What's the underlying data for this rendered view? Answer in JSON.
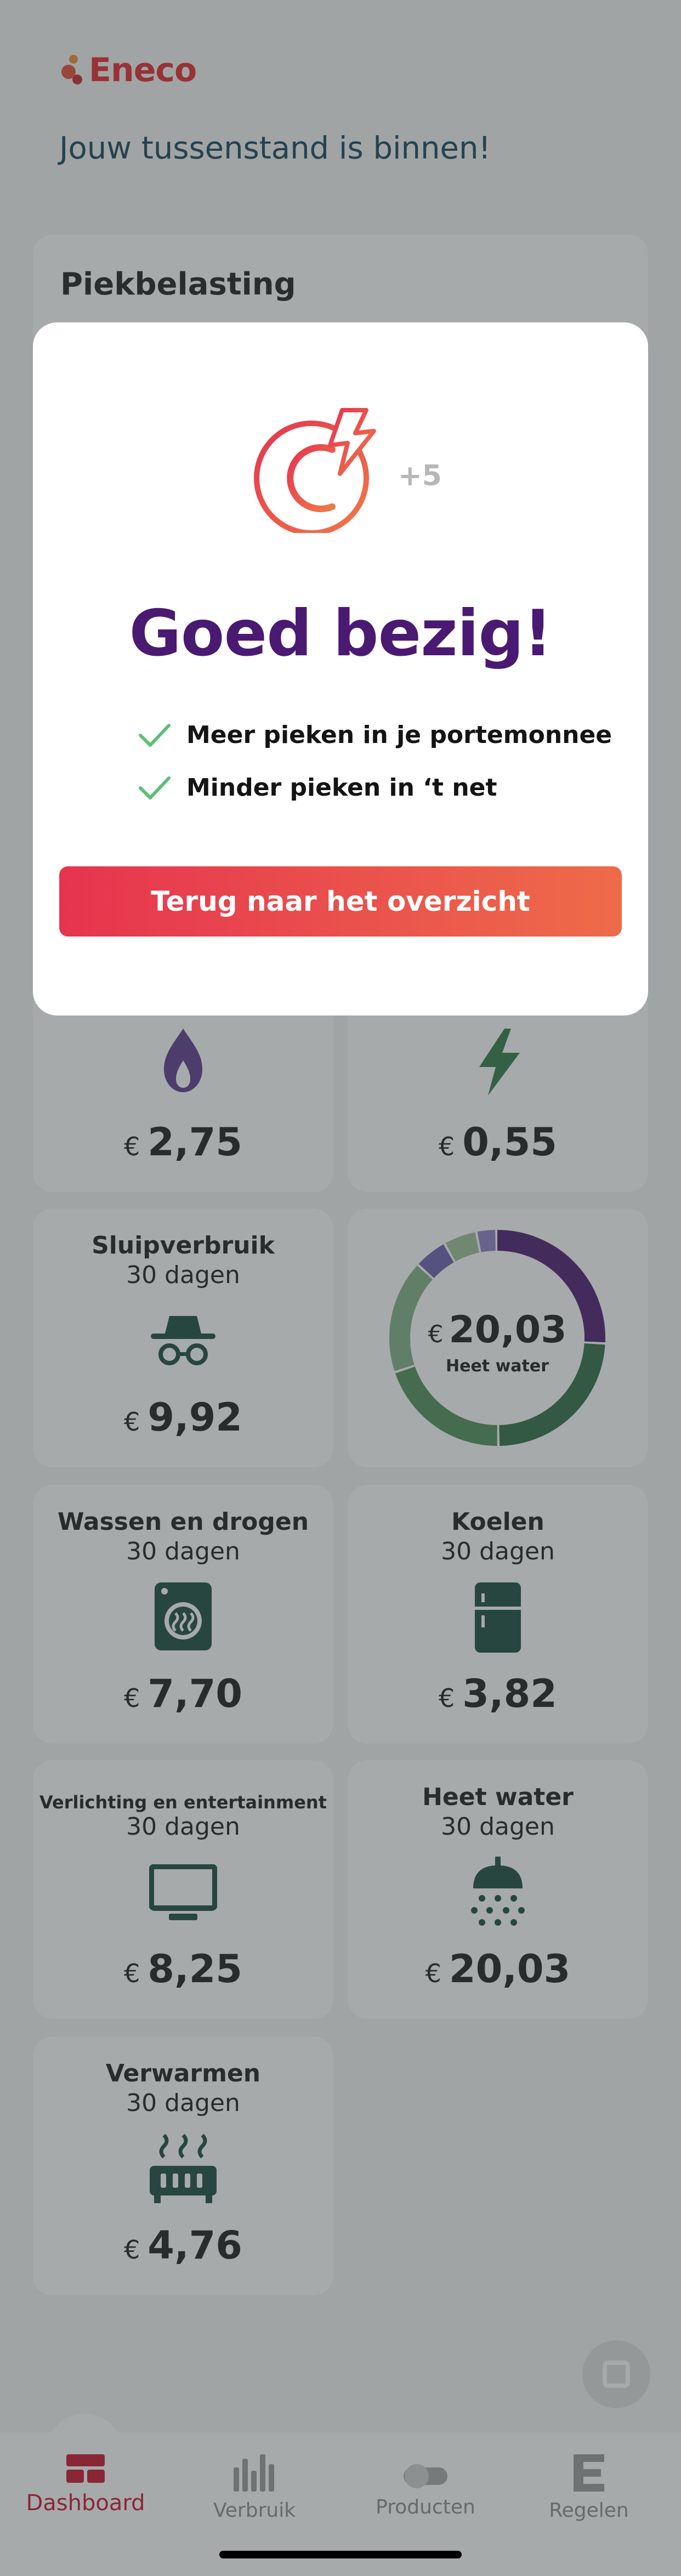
{
  "app": {
    "brand": "Eneco",
    "welcome": "Jouw tussenstand is binnen!",
    "accent_color": "#e3262f",
    "dark_green": "#174a3c",
    "purple": "#4a1a72"
  },
  "peak_card": {
    "title": "Piekbelasting"
  },
  "tiles": {
    "gas": {
      "amount": "2,75",
      "currency": "€",
      "icon": "flame-icon"
    },
    "electricity": {
      "amount": "0,55",
      "currency": "€",
      "icon": "lightning-icon"
    },
    "standby": {
      "title": "Sluipverbruik",
      "period": "30 dagen",
      "amount": "9,92",
      "currency": "€",
      "icon": "spy-icon"
    },
    "laundry": {
      "title": "Wassen en drogen",
      "period": "30 dagen",
      "amount": "7,70",
      "currency": "€",
      "icon": "washing-machine-icon"
    },
    "cooling": {
      "title": "Koelen",
      "period": "30 dagen",
      "amount": "3,82",
      "currency": "€",
      "icon": "fridge-icon"
    },
    "lighting": {
      "title": "Verlichting en entertainment",
      "period": "30 dagen",
      "amount": "8,25",
      "currency": "€",
      "icon": "monitor-icon"
    },
    "hot_water": {
      "title": "Heet water",
      "period": "30 dagen",
      "amount": "20,03",
      "currency": "€",
      "icon": "shower-icon"
    },
    "heating": {
      "title": "Verwarmen",
      "period": "30 dagen",
      "amount": "4,76",
      "currency": "€",
      "icon": "radiator-icon"
    }
  },
  "donut": {
    "currency": "€",
    "amount": "20,03",
    "caption": "Heet water",
    "segments": [
      {
        "color": "#4a1a72",
        "fraction": 0.26
      },
      {
        "color": "#2d6a44",
        "fraction": 0.24
      },
      {
        "color": "#4f8f5a",
        "fraction": 0.2
      },
      {
        "color": "#7fb088",
        "fraction": 0.17
      },
      {
        "color": "#6b5fb3",
        "fraction": 0.05
      },
      {
        "color": "#9bbf9a",
        "fraction": 0.05
      },
      {
        "color": "#8b7ec8",
        "fraction": 0.03
      }
    ]
  },
  "modal": {
    "bonus": "+5",
    "title": "Goed bezig!",
    "benefits": [
      "Meer pieken in je portemonnee",
      "Minder pieken in ‘t net"
    ],
    "cta": "Terug naar het overzicht",
    "icon": "euro-lightning-icon"
  },
  "nav": {
    "items": [
      {
        "label": "Dashboard",
        "icon": "dashboard-icon",
        "active": true
      },
      {
        "label": "Verbruik",
        "icon": "bar-chart-icon",
        "active": false
      },
      {
        "label": "Producten",
        "icon": "toggle-icon",
        "active": false
      },
      {
        "label": "Regelen",
        "icon": "e-logo-icon",
        "active": false
      }
    ]
  }
}
